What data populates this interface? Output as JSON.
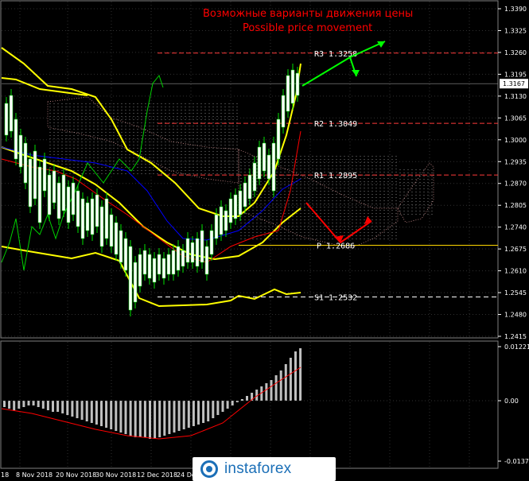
{
  "title_ru": "Возможные варианты движения цены",
  "title_en": "Possible price movement",
  "price_axis": [
    "1.3390",
    "1.3325",
    "1.3260",
    "1.3195",
    "1.3130",
    "1.3065",
    "1.3000",
    "1.2935",
    "1.2870",
    "1.2805",
    "1.2740",
    "1.2675",
    "1.2610",
    "1.2545",
    "1.2480",
    "1.2415"
  ],
  "current_price": "1.3167",
  "osc_axis": [
    "0.01221",
    "0.00",
    "-0.0137"
  ],
  "dates": [
    "8 Nov 2018",
    "20 Nov 2018",
    "30 Nov 2018",
    "12 Dec 2018",
    "24 Dec"
  ],
  "edge_label": "18",
  "logo_text": "instaforex",
  "chart_data": {
    "type": "candlestick",
    "levels": [
      {
        "name": "R3",
        "value": "1.3258",
        "color": "#ff3b3b"
      },
      {
        "name": "R2",
        "value": "1.3049",
        "color": "#ff3b3b"
      },
      {
        "name": "R1",
        "value": "1.2895",
        "color": "#ff3b3b"
      },
      {
        "name": "P",
        "value": "1.2686",
        "color": "#ffd700"
      },
      {
        "name": "S1",
        "value": "1.2532",
        "color": "#ffffff"
      }
    ],
    "ylim": [
      1.2415,
      1.339
    ],
    "grid": true,
    "colors": {
      "bull": "#00e000",
      "bear": "#00e000",
      "bands": "#ffff00",
      "kijun": "#ff0000",
      "tenkan": "#0000ff",
      "chikou": "#00d000",
      "arrow_up": "#00ff00",
      "arrow_down": "#ff0000",
      "histogram": "#c0c0c0",
      "signal": "#ff0000"
    }
  }
}
